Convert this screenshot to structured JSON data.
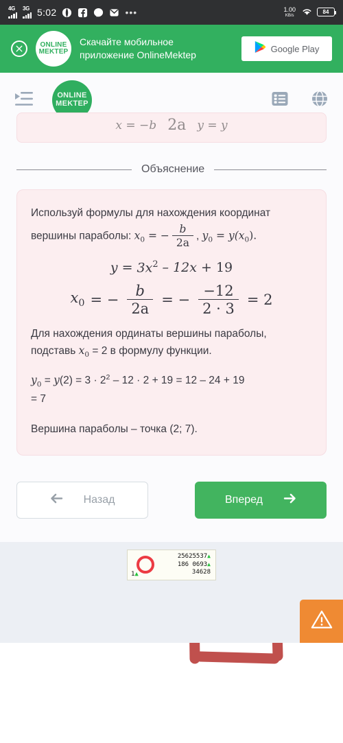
{
  "status_bar": {
    "network_1": "4G",
    "network_2": "3G",
    "time": "5:02",
    "overflow": "•••",
    "net_speed_value": "1.00",
    "net_speed_unit": "KB/s",
    "battery": "84",
    "icons": [
      "opera-icon",
      "facebook-icon",
      "messenger-icon",
      "mail-icon"
    ]
  },
  "app_banner": {
    "close_icon": "close-icon",
    "logo_line1": "ONLINE",
    "logo_line2": "MEKTEP",
    "text_line1": "Скачайте мобильное",
    "text_line2": "приложение OnlineMektep",
    "store_button": "Google Play",
    "bg_color": "#32b05f"
  },
  "navbar": {
    "menu_icon": "menu-indent-icon",
    "logo_line1": "ONLINE",
    "logo_line2": "MEKTEP",
    "list_icon": "list-icon",
    "globe_icon": "globe-icon",
    "logo_color": "#2fae5f"
  },
  "cut_card": {
    "fragment_left": "x = −b",
    "fragment_den": "2a",
    "fragment_right": "y = y"
  },
  "divider": {
    "label": "Объяснение"
  },
  "explanation": {
    "intro_part1": "Используй формулы для нахождения координат вершины параболы: ",
    "intro_x": "x",
    "intro_x_sub": "0",
    "intro_eq": " = −",
    "frac_num": "b",
    "frac_den": "2a",
    "intro_comma": ",",
    "intro_y": "y",
    "intro_y_sub": "0",
    "intro_y_eq": " = ",
    "intro_y_fn": "y",
    "intro_y_arg": "(x",
    "intro_y_arg_sub": "0",
    "intro_y_end": ").",
    "function_formula": {
      "lhs": "y",
      "eq": "=",
      "term1": "3x",
      "term1_sup": "2",
      "term2": "– 12x",
      "term3": "+ 19"
    },
    "x0_formula": {
      "lhs": "x",
      "lhs_sub": "0",
      "eq1": "= −",
      "frac1_num": "b",
      "frac1_den": "2a",
      "eq2": "= −",
      "frac2_num": "−12",
      "frac2_den": "2 · 3",
      "eq3": "= 2"
    },
    "para2_part1": "Для нахождения ординаты вершины параболы, подставь ",
    "para2_x": "x",
    "para2_x_sub": "0",
    "para2_part2": " = 2 в формулу функции.",
    "y0_line1_a": "y",
    "y0_line1_a_sub": "0",
    "y0_line1_b": " = ",
    "y0_line1_fn": "y",
    "y0_line1_rest": "(2) = 3 · 2",
    "y0_line1_sup": "2",
    "y0_line1_rest2": " – 12 · 2 + 19 = 12 – 24 + 19",
    "y0_line2": "= 7",
    "conclusion": "Вершина параболы – точка (2; 7).",
    "card_bg": "#fceef0"
  },
  "annotation": {
    "shape": "hand-drawn-rectangle",
    "color": "#c0504d"
  },
  "buttons": {
    "back_label": "Назад",
    "back_icon": "arrow-left-icon",
    "next_label": "Вперед",
    "next_icon": "arrow-right-icon",
    "next_color": "#42b45f"
  },
  "footer": {
    "counter": {
      "ring_color": "#ec3b43",
      "row1": "25625537",
      "row2": "186 0693",
      "row3": "34628",
      "corner": "1",
      "triangle": "▲"
    },
    "fab": {
      "icon": "warning-triangle-icon",
      "color": "#ef8a33"
    }
  }
}
